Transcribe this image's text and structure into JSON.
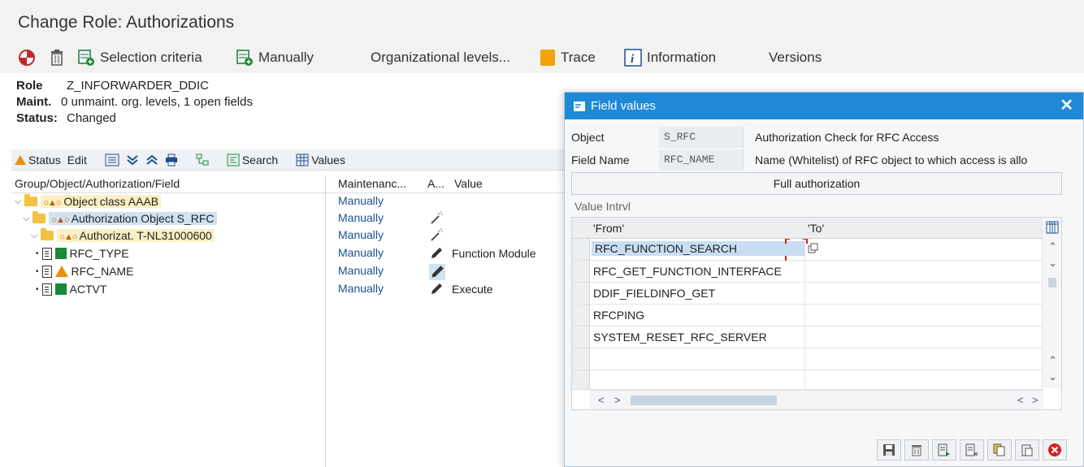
{
  "window": {
    "title": "Change Role: Authorizations"
  },
  "toolbar": {
    "selection_criteria": "Selection criteria",
    "manually": "Manually",
    "org_levels": "Organizational levels...",
    "trace": "Trace",
    "information": "Information",
    "versions": "Versions"
  },
  "header": {
    "role_label": "Role",
    "role_value": "Z_INFORWARDER_DDIC",
    "maint_label": "Maint.",
    "maint_value": "0 unmaint. org. levels, 1 open fields",
    "status_label": "Status:",
    "status_value": "Changed"
  },
  "tree_toolbar": {
    "status": "Status",
    "edit": "Edit",
    "search": "Search",
    "values": "Values"
  },
  "tree_columns": {
    "group": "Group/Object/Authorization/Field",
    "maintenance": "Maintenanc...",
    "a": "A...",
    "value": "Value"
  },
  "tree_rows": [
    {
      "label": "Object class AAAB",
      "maintenance": "Manually",
      "value": ""
    },
    {
      "label": "Authorization Object S_RFC",
      "maintenance": "Manually",
      "value": ""
    },
    {
      "label": "Authorizat. T-NL31000600",
      "maintenance": "Manually",
      "value": ""
    },
    {
      "label": "RFC_TYPE",
      "maintenance": "Manually",
      "value": "Function Module"
    },
    {
      "label": "RFC_NAME",
      "maintenance": "Manually",
      "value": ""
    },
    {
      "label": "ACTVT",
      "maintenance": "Manually",
      "value": "Execute"
    }
  ],
  "dialog": {
    "title": "Field values",
    "object_label": "Object",
    "object_value": "S_RFC",
    "object_desc": "Authorization Check for RFC Access",
    "field_label": "Field Name",
    "field_value": "RFC_NAME",
    "field_desc": "Name (Whitelist) of RFC object to which access is allo",
    "full_auth": "Full authorization",
    "value_interval": "Value Intrvl",
    "col_from": "'From'",
    "col_to": "'To'",
    "values": [
      "RFC_FUNCTION_SEARCH",
      "RFC_GET_FUNCTION_INTERFACE",
      "DDIF_FIELDINFO_GET",
      "RFCPING",
      "SYSTEM_RESET_RFC_SERVER",
      "",
      ""
    ]
  },
  "colors": {
    "dialog_header": "#1e89d6",
    "manually_text": "#1d4f91",
    "selection": "#c9def3",
    "green_status": "#1a8a3a",
    "orange_status": "#e8900c"
  }
}
